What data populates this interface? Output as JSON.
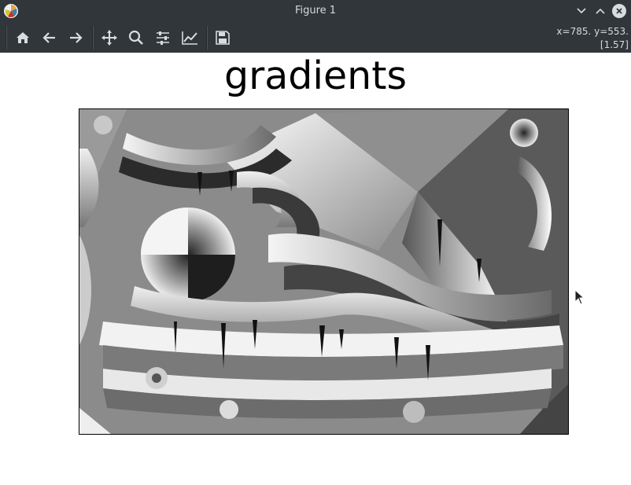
{
  "window": {
    "title": "Figure 1",
    "app_icon": "matplotlib-logo-icon",
    "controls": [
      "minimize-icon",
      "maximize-icon",
      "close-icon"
    ]
  },
  "toolbar": {
    "buttons": [
      {
        "name": "home",
        "icon": "home-icon"
      },
      {
        "name": "back",
        "icon": "arrow-left-icon"
      },
      {
        "name": "forward",
        "icon": "arrow-right-icon"
      },
      {
        "name": "pan",
        "icon": "move-icon"
      },
      {
        "name": "zoom",
        "icon": "magnifier-icon"
      },
      {
        "name": "subplots",
        "icon": "sliders-icon"
      },
      {
        "name": "edit-axes",
        "icon": "line-chart-icon"
      },
      {
        "name": "save",
        "icon": "floppy-disk-icon"
      }
    ],
    "coords_line1": "x=785. y=553.",
    "coords_line2": "[1.57]"
  },
  "figure": {
    "title": "gradients",
    "image_content": "grayscale gradient-orientation map of a sneaker",
    "colors": {
      "chrome_bg": "#31363b",
      "chrome_text": "#d7dadc",
      "figure_bg": "#ffffff"
    }
  }
}
